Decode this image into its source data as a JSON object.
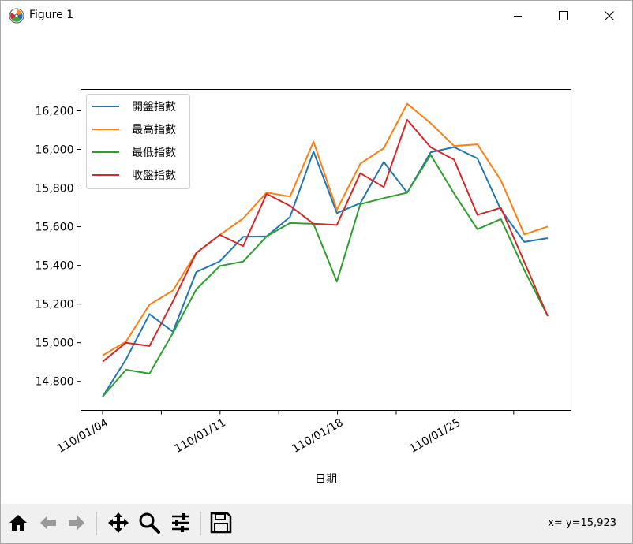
{
  "window": {
    "title": "Figure 1",
    "coord_readout": "x= y=15,923"
  },
  "icons": {
    "app": "matplotlib-icon",
    "minimize": "minimize-icon",
    "maximize": "maximize-icon",
    "close": "close-icon",
    "toolbar": [
      "home-icon",
      "back-arrow-icon",
      "forward-arrow-icon",
      "pan-icon",
      "zoom-icon",
      "configure-subplots-icon",
      "save-icon"
    ]
  },
  "chart_data": {
    "type": "line",
    "xlabel": "日期",
    "ylabel": "",
    "title": "",
    "xticks": [
      "110/01/04",
      "110/01/11",
      "110/01/18",
      "110/01/25"
    ],
    "ylim": [
      14650,
      16310
    ],
    "yticks": [
      "14,800",
      "15,000",
      "15,200",
      "15,400",
      "15,600",
      "15,800",
      "16,000",
      "16,200"
    ],
    "legend_position": "upper left",
    "x": [
      "110/01/04",
      "110/01/05",
      "110/01/06",
      "110/01/07",
      "110/01/08",
      "110/01/11",
      "110/01/12",
      "110/01/13",
      "110/01/14",
      "110/01/15",
      "110/01/18",
      "110/01/19",
      "110/01/20",
      "110/01/21",
      "110/01/22",
      "110/01/25",
      "110/01/26",
      "110/01/27",
      "110/01/28",
      "110/01/29"
    ],
    "series": [
      {
        "name": "開盤指數",
        "color": "#1f77b4",
        "values": [
          14721,
          14914,
          15148,
          15057,
          15366,
          15421,
          15548,
          15550,
          15651,
          15990,
          15671,
          15722,
          15935,
          15776,
          15985,
          16012,
          15953,
          15688,
          15521,
          15541
        ]
      },
      {
        "name": "最高指數",
        "color": "#ff7f0e",
        "values": [
          14934,
          15006,
          15197,
          15270,
          15465,
          15557,
          15643,
          15777,
          15756,
          16040,
          15688,
          15926,
          16006,
          16236,
          16136,
          16018,
          16026,
          15840,
          15560,
          15601
        ]
      },
      {
        "name": "最低指數",
        "color": "#2ca02c",
        "values": [
          14721,
          14860,
          14840,
          15050,
          15276,
          15397,
          15420,
          15550,
          15619,
          15615,
          15316,
          15717,
          15748,
          15776,
          15972,
          15772,
          15587,
          15640,
          15375,
          15138
        ]
      },
      {
        "name": "收盤指數",
        "color": "#d62728",
        "values": [
          14902,
          15000,
          14983,
          15214,
          15464,
          15558,
          15500,
          15770,
          15708,
          15616,
          15609,
          15877,
          15805,
          16153,
          16011,
          15947,
          15661,
          15698,
          15417,
          15138
        ]
      }
    ]
  }
}
